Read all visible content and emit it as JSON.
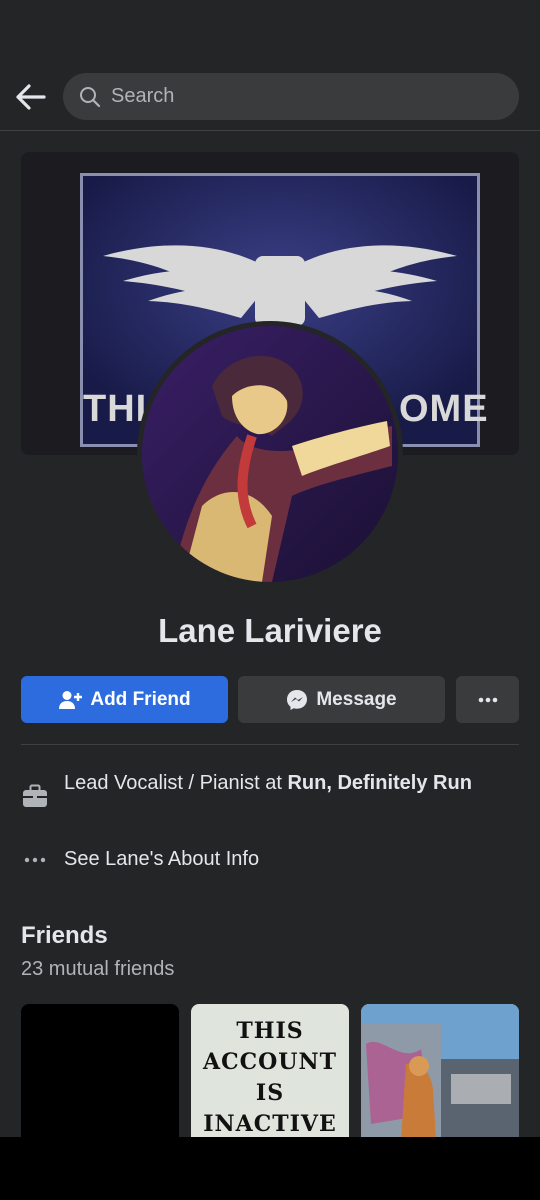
{
  "header": {
    "search_placeholder": "Search",
    "back_icon": "arrow-left-icon",
    "search_icon": "search-icon"
  },
  "cover": {
    "text_left": "THI",
    "text_right": "OME"
  },
  "profile": {
    "name": "Lane Lariviere"
  },
  "actions": {
    "add_friend": "Add Friend",
    "message": "Message",
    "more_icon": "more-dots-icon"
  },
  "info": {
    "work_prefix": "Lead Vocalist / Pianist at ",
    "work_place": "Run, Definitely Run",
    "about": "See Lane's About Info"
  },
  "friends": {
    "title": "Friends",
    "subtitle": "23 mutual friends",
    "tiles": [
      {
        "caption": ""
      },
      {
        "lines": [
          "THIS",
          "ACCOUNT",
          "IS",
          "INACTIVE"
        ]
      },
      {
        "caption": ""
      }
    ]
  },
  "colors": {
    "background": "#242526",
    "primary_button": "#2d6cdf",
    "secondary_button": "#3a3b3c",
    "text": "#e4e6eb",
    "muted": "#b0b3b8"
  }
}
